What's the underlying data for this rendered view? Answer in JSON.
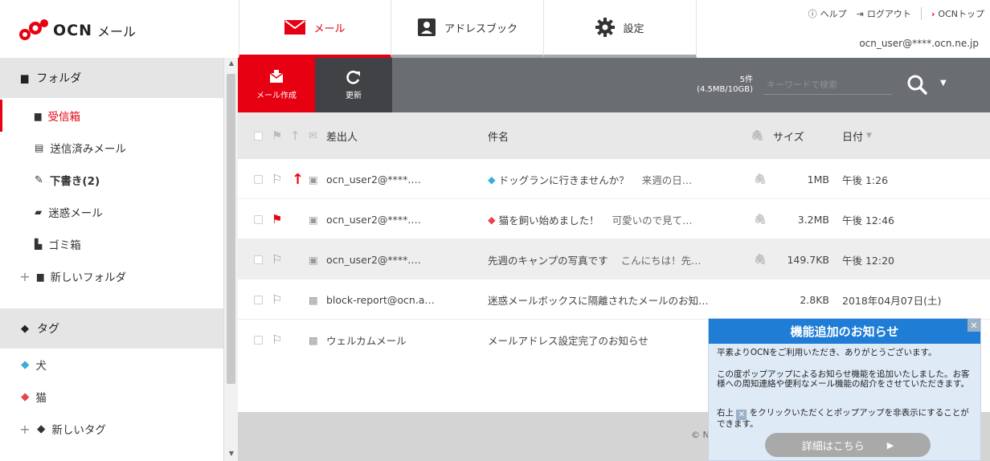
{
  "header": {
    "logo_brand": "OCN",
    "logo_product": "メール",
    "tabs": [
      {
        "label": "メール",
        "icon": "mail-icon",
        "active": true
      },
      {
        "label": "アドレスブック",
        "icon": "address-book-icon",
        "active": false
      },
      {
        "label": "設定",
        "icon": "gear-icon",
        "active": false
      }
    ],
    "links": {
      "help": "ヘルプ",
      "logout": "ログアウト",
      "ocn_top": "OCNトップ"
    },
    "user_address": "ocn_user@****.ocn.ne.jp"
  },
  "sidebar": {
    "folder_header": "フォルダ",
    "folders": [
      {
        "label": "受信箱",
        "icon": "folder-icon",
        "active": true
      },
      {
        "label": "送信済みメール",
        "icon": "sent-icon",
        "active": false
      },
      {
        "label": "下書き(2)",
        "icon": "draft-icon",
        "active": false
      },
      {
        "label": "迷惑メール",
        "icon": "spam-icon",
        "active": false
      },
      {
        "label": "ゴミ箱",
        "icon": "trash-icon",
        "active": false
      }
    ],
    "new_folder": "新しいフォルダ",
    "tag_header": "タグ",
    "tags": [
      {
        "label": "犬",
        "color": "#3aaed8"
      },
      {
        "label": "猫",
        "color": "#e8424e"
      }
    ],
    "new_tag": "新しいタグ"
  },
  "toolbar": {
    "compose_label": "メール作成",
    "refresh_label": "更新",
    "quota_count": "5件",
    "quota_size": "(4.5MB/10GB)",
    "search_placeholder": "キーワードで検索"
  },
  "list": {
    "col_sender": "差出人",
    "col_subject": "件名",
    "col_size": "サイズ",
    "col_date": "日付",
    "rows": [
      {
        "sender": "ocn_user2@****.…",
        "subject": "ドッグランに行きませんか？",
        "preview": "来週の日…",
        "size": "1MB",
        "date": "午後 1:26",
        "tag_color": "#3aaed8",
        "flagged": false,
        "priority": true,
        "attachment": true,
        "selected": false
      },
      {
        "sender": "ocn_user2@****.…",
        "subject": "猫を飼い始めました！",
        "preview": "可愛いので見て…",
        "size": "3.2MB",
        "date": "午後 12:46",
        "tag_color": "#e8424e",
        "flagged": true,
        "priority": false,
        "attachment": true,
        "selected": false
      },
      {
        "sender": "ocn_user2@****.…",
        "subject": "先週のキャンプの写真です",
        "preview": "こんにちは！先…",
        "size": "149.7KB",
        "date": "午後 12:20",
        "tag_color": "",
        "flagged": false,
        "priority": false,
        "attachment": true,
        "selected": true
      },
      {
        "sender": "block-report@ocn.a…",
        "subject": "迷惑メールボックスに隔離されたメールのお知…",
        "preview": "",
        "size": "2.8KB",
        "date": "2018年04月07日(土)",
        "tag_color": "",
        "flagged": false,
        "priority": false,
        "attachment": false,
        "selected": false
      },
      {
        "sender": "ウェルカムメール",
        "subject": "メールアドレス設定完了のお知らせ",
        "preview": "",
        "size": "",
        "date": "",
        "tag_color": "",
        "flagged": false,
        "priority": false,
        "attachment": false,
        "selected": false
      }
    ]
  },
  "footer": {
    "copyright": "© N"
  },
  "popup": {
    "title": "機能追加のお知らせ",
    "line1": "平素よりOCNをご利用いただき、ありがとうございます。",
    "line2": "この度ポップアップによるお知らせ機能を追加いたしました。お客様への周知連絡や便利なメール機能の紹介をさせていただきます。",
    "line3_pre": "右上",
    "line3_post": "をクリックいただくとポップアップを非表示にすることができます。",
    "button": "詳細はこちら"
  }
}
